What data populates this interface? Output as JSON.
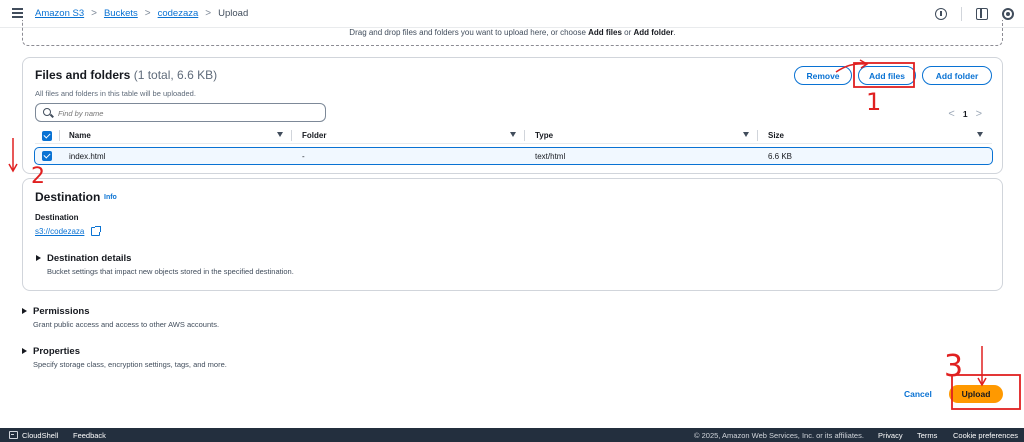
{
  "breadcrumb": {
    "items": [
      "Amazon S3",
      "Buckets",
      "codezaza"
    ],
    "current": "Upload",
    "separator": ">"
  },
  "dropzone": {
    "text_prefix": "Drag and drop files and folders you want to upload here, or choose ",
    "add_files": "Add files",
    "or": " or ",
    "add_folder": "Add folder",
    "suffix": "."
  },
  "files_section": {
    "title": "Files and folders",
    "count": "(1 total, 6.6 KB)",
    "subtitle": "All files and folders in this table will be uploaded.",
    "buttons": {
      "remove": "Remove",
      "add_files": "Add files",
      "add_folder": "Add folder"
    },
    "search_placeholder": "Find by name",
    "pagination": {
      "prev": "<",
      "page": "1",
      "next": ">"
    },
    "columns": [
      "Name",
      "Folder",
      "Type",
      "Size"
    ],
    "rows": [
      {
        "name": "index.html",
        "folder": "-",
        "type": "text/html",
        "size": "6.6 KB",
        "selected": true
      }
    ]
  },
  "destination": {
    "title": "Destination",
    "info": "Info",
    "label": "Destination",
    "link": "s3://codezaza",
    "details_title": "Destination details",
    "details_desc": "Bucket settings that impact new objects stored in the specified destination."
  },
  "permissions": {
    "title": "Permissions",
    "desc": "Grant public access and access to other AWS accounts."
  },
  "properties": {
    "title": "Properties",
    "desc": "Specify storage class, encryption settings, tags, and more."
  },
  "actions": {
    "cancel": "Cancel",
    "upload": "Upload"
  },
  "footer": {
    "cloudshell": "CloudShell",
    "feedback": "Feedback",
    "copyright": "© 2025, Amazon Web Services, Inc. or its affiliates.",
    "privacy": "Privacy",
    "terms": "Terms",
    "cookie": "Cookie preferences"
  },
  "annotations": {
    "step1": "1",
    "step2": "2",
    "step3": "3"
  },
  "colors": {
    "link": "#0972d3",
    "primary_button": "#ff9900",
    "annotation_red": "#e02020",
    "footer_bg": "#232f3e"
  }
}
